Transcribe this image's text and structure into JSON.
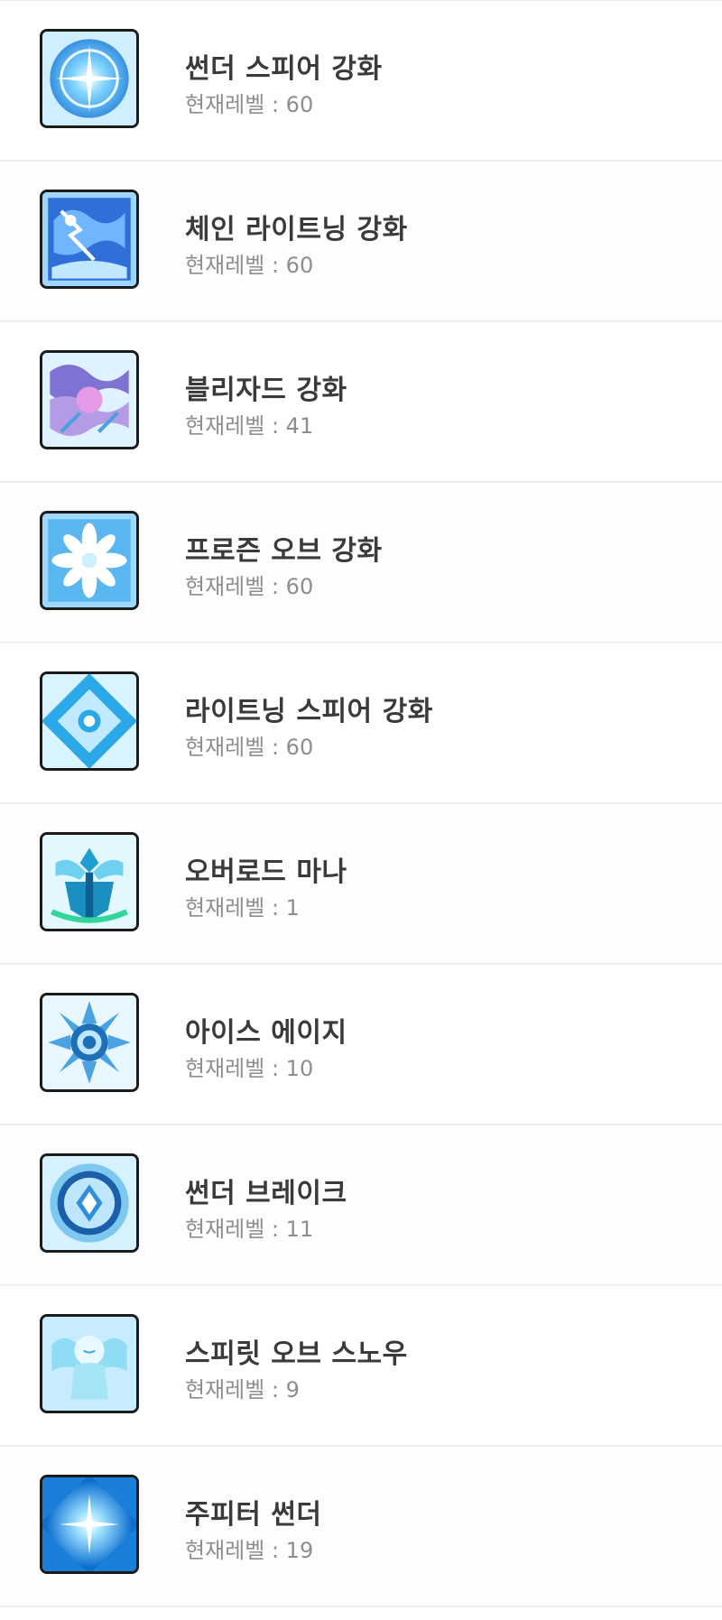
{
  "level_separator": " : ",
  "skills": [
    {
      "name": "썬더 스피어 강화",
      "level_label": "현재레벨",
      "level": "60",
      "icon": "thunder-sphere-boost-icon",
      "color": "#2f9de8"
    },
    {
      "name": "체인 라이트닝 강화",
      "level_label": "현재레벨",
      "level": "60",
      "icon": "chain-lightning-boost-icon",
      "color": "#2e6fd8"
    },
    {
      "name": "블리자드 강화",
      "level_label": "현재레벨",
      "level": "41",
      "icon": "blizzard-boost-icon",
      "color": "#8a7fd6"
    },
    {
      "name": "프로즌 오브 강화",
      "level_label": "현재레벨",
      "level": "60",
      "icon": "frozen-orb-boost-icon",
      "color": "#3aa6e0"
    },
    {
      "name": "라이트닝 스피어 강화",
      "level_label": "현재레벨",
      "level": "60",
      "icon": "lightning-spear-boost-icon",
      "color": "#2cb4e8"
    },
    {
      "name": "오버로드 마나",
      "level_label": "현재레벨",
      "level": "1",
      "icon": "overload-mana-icon",
      "color": "#1fa3c7"
    },
    {
      "name": "아이스 에이지",
      "level_label": "현재레벨",
      "level": "10",
      "icon": "ice-age-icon",
      "color": "#1d6fb8"
    },
    {
      "name": "썬더 브레이크",
      "level_label": "현재레벨",
      "level": "11",
      "icon": "thunder-break-icon",
      "color": "#1a5fa8"
    },
    {
      "name": "스피릿 오브 스노우",
      "level_label": "현재레벨",
      "level": "9",
      "icon": "spirit-of-snow-icon",
      "color": "#5cc6e8"
    },
    {
      "name": "주피터 썬더",
      "level_label": "현재레벨",
      "level": "19",
      "icon": "jupiter-thunder-icon",
      "color": "#1e88e0"
    }
  ]
}
